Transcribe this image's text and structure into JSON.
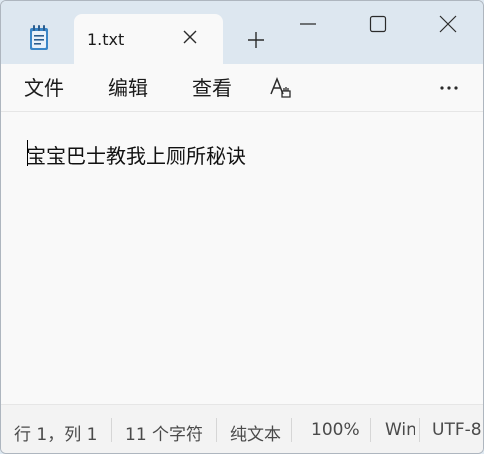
{
  "tab": {
    "title": "1.txt"
  },
  "menu": {
    "file": "文件",
    "edit": "编辑",
    "view": "查看"
  },
  "editor": {
    "content": "宝宝巴士教我上厕所秘诀"
  },
  "status": {
    "position": "行 1，列 1",
    "char_count": "11 个字符",
    "format": "纯文本",
    "zoom": "100%",
    "line_ending": "Windows (CRLF)",
    "encoding": "UTF-8"
  },
  "icons": {
    "app": "notepad-icon",
    "tab_close": "close-icon",
    "new_tab": "plus-icon",
    "minimize": "minimize-icon",
    "maximize": "maximize-icon",
    "close": "close-icon",
    "format": "font-format-icon",
    "more": "more-icon"
  },
  "colors": {
    "titlebar_bg": "#dde7f0",
    "content_bg": "#f9f9f9",
    "statusbar_bg": "#f3f3f3"
  }
}
